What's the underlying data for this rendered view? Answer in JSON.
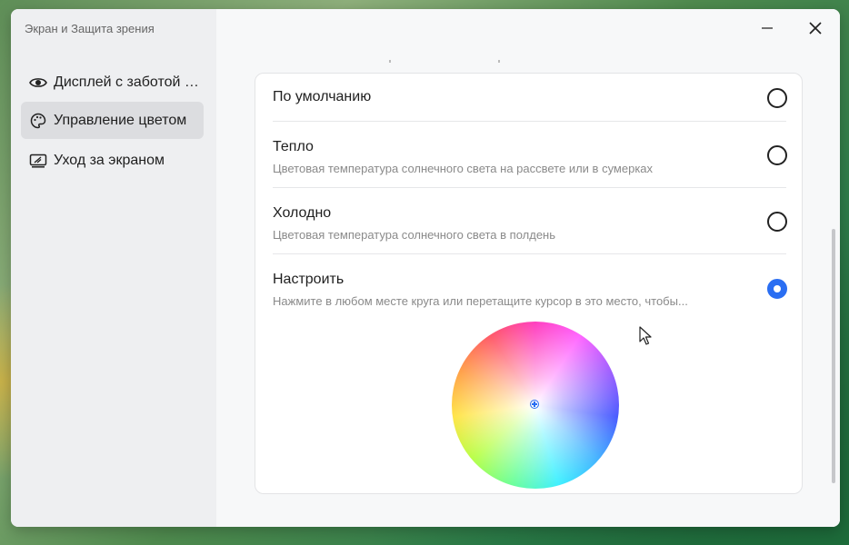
{
  "window": {
    "title": "Экран и Защита зрения"
  },
  "sidebar": {
    "items": [
      {
        "label": "Дисплей с заботой о..."
      },
      {
        "label": "Управление цветом"
      },
      {
        "label": "Уход за экраном"
      }
    ]
  },
  "options": [
    {
      "title": "По умолчанию",
      "desc": ""
    },
    {
      "title": "Тепло",
      "desc": "Цветовая температура солнечного света на рассвете или в сумерках"
    },
    {
      "title": "Холодно",
      "desc": "Цветовая температура солнечного света в полдень"
    },
    {
      "title": "Настроить",
      "desc": "Нажмите в любом месте круга или перетащите курсор в это место, чтобы..."
    }
  ],
  "selected_option": "Настроить",
  "colors": {
    "accent": "#2a6ef2",
    "sidebar_bg": "#eeeff1",
    "active_item_bg": "#dcdde0"
  }
}
